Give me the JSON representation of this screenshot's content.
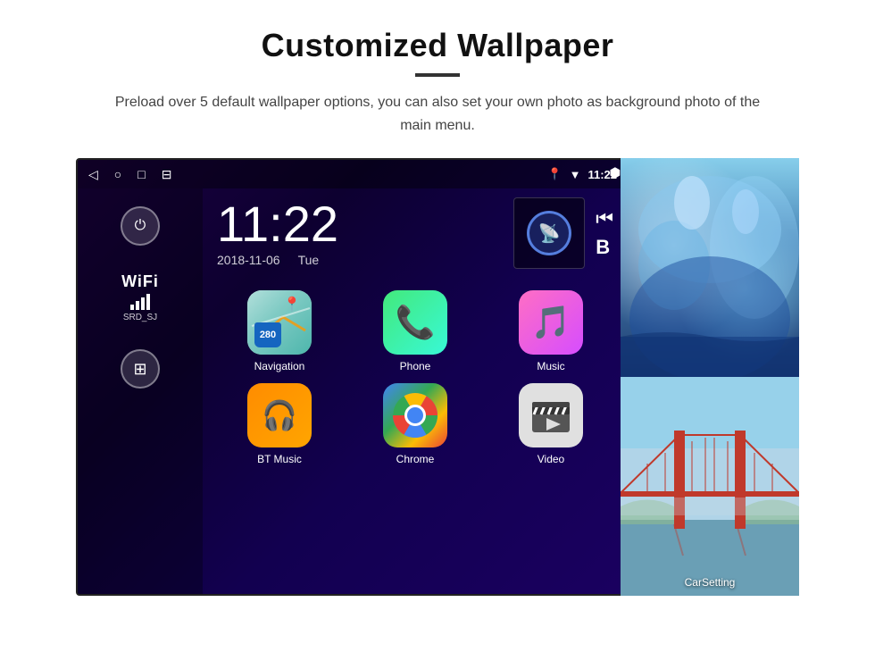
{
  "header": {
    "title": "Customized Wallpaper",
    "divider": true,
    "description": "Preload over 5 default wallpaper options, you can also set your own photo as background photo of the main menu."
  },
  "android": {
    "status_bar": {
      "time": "11:22",
      "nav_icons": [
        "◁",
        "○",
        "□",
        "⊟"
      ],
      "right_icons": [
        "location",
        "wifi",
        "time"
      ]
    },
    "clock": {
      "time": "11:22",
      "date": "2018-11-06",
      "day": "Tue"
    },
    "wifi": {
      "label": "WiFi",
      "ssid": "SRD_SJ"
    },
    "apps": [
      {
        "name": "Navigation",
        "type": "navigation"
      },
      {
        "name": "Phone",
        "type": "phone"
      },
      {
        "name": "Music",
        "type": "music"
      },
      {
        "name": "BT Music",
        "type": "bt"
      },
      {
        "name": "Chrome",
        "type": "chrome"
      },
      {
        "name": "Video",
        "type": "video"
      }
    ],
    "wallpapers": [
      {
        "name": "ice",
        "label": ""
      },
      {
        "name": "bridge",
        "label": "CarSetting"
      }
    ]
  }
}
